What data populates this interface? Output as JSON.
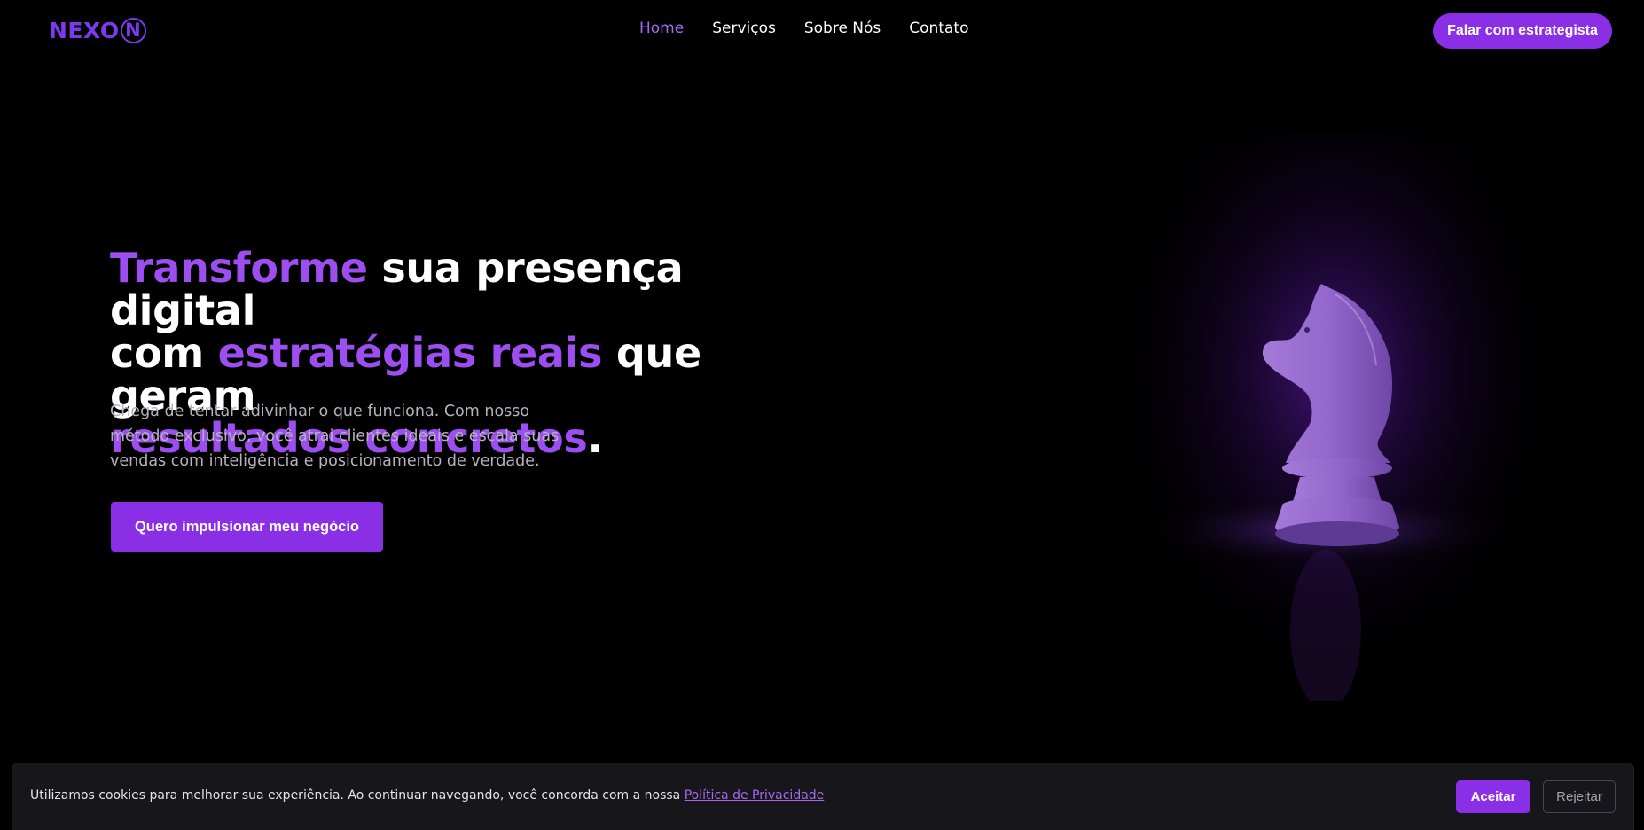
{
  "header": {
    "logo_text": "NEXO",
    "logo_ring_letter": "N",
    "nav": [
      {
        "label": "Home",
        "active": true
      },
      {
        "label": "Serviços",
        "active": false
      },
      {
        "label": "Sobre Nós",
        "active": false
      },
      {
        "label": "Contato",
        "active": false
      }
    ],
    "cta_label": "Falar com estrategista"
  },
  "hero": {
    "title_parts": [
      "Transforme",
      " sua presença digital ",
      "com ",
      "estratégias reais",
      " que geram ",
      "resultados concretos",
      "."
    ],
    "subtitle": "Chega de tentar adivinhar o que funciona. Com nosso método exclusivo, você atrai clientes ideais e escala suas vendas com inteligência e posicionamento de verdade.",
    "button_label": "Quero impulsionar meu negócio"
  },
  "visual": {
    "icon": "chess-knight-icon"
  },
  "cookie": {
    "text": "Utilizamos cookies para melhorar sua experiência. Ao continuar navegando, você concorda com a nossa ",
    "link_label": "Política de Privacidade",
    "accept_label": "Aceitar",
    "reject_label": "Rejeitar"
  },
  "colors": {
    "accent": "#8b2fe6",
    "accent_text": "#9d4ef0",
    "background": "#000000"
  }
}
